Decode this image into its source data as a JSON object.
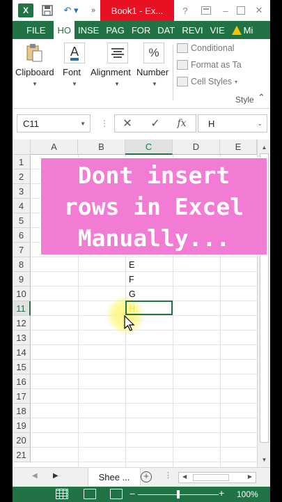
{
  "titlebar": {
    "app_icon": "X",
    "document_title": "Book1 - Ex...",
    "icons": [
      "excel-logo-icon",
      "save-icon",
      "undo-icon",
      "help-icon",
      "ribbon-display-icon",
      "minimize-icon",
      "maximize-icon",
      "close-icon"
    ]
  },
  "tabs": [
    {
      "label": "FILE"
    },
    {
      "label": "HO"
    },
    {
      "label": "INSE"
    },
    {
      "label": "PAG"
    },
    {
      "label": "FOR"
    },
    {
      "label": "DAT"
    },
    {
      "label": "REVI"
    },
    {
      "label": "VIE"
    },
    {
      "label": "Mi"
    }
  ],
  "ribbon": {
    "clipboard_label": "Clipboard",
    "font_label": "Font",
    "alignment_label": "Alignment",
    "number_label": "Number",
    "number_icon": "%",
    "font_icon": "A",
    "styles": {
      "conditional": "Conditional",
      "format_as": "Format as Ta",
      "cell_styles": "Cell Styles",
      "group_label": "Style"
    }
  },
  "formula_bar": {
    "name_box": "C11",
    "fx": "fx",
    "value": "H"
  },
  "grid": {
    "columns": [
      "A",
      "B",
      "C",
      "D",
      "E"
    ],
    "rows": [
      "1",
      "2",
      "3",
      "4",
      "5",
      "6",
      "7",
      "8",
      "9",
      "10",
      "11",
      "12",
      "13",
      "14",
      "15",
      "16",
      "17",
      "18",
      "19",
      "20",
      "21"
    ],
    "cells": [
      {
        "ref": "C8",
        "value": "E"
      },
      {
        "ref": "C9",
        "value": "F"
      },
      {
        "ref": "C10",
        "value": "G"
      },
      {
        "ref": "C11",
        "value": "H"
      }
    ],
    "active_cell": "C11"
  },
  "overlay": {
    "text": "Dont insert\nrows in Excel\nManually..."
  },
  "sheetbar": {
    "sheet_tab": "Shee ..."
  },
  "statusbar": {
    "zoom": "100%"
  },
  "colors": {
    "excel_green": "#217346",
    "title_red": "#e81123",
    "overlay_pink": "#f27bd3",
    "highlight_yellow": "#fff578"
  }
}
